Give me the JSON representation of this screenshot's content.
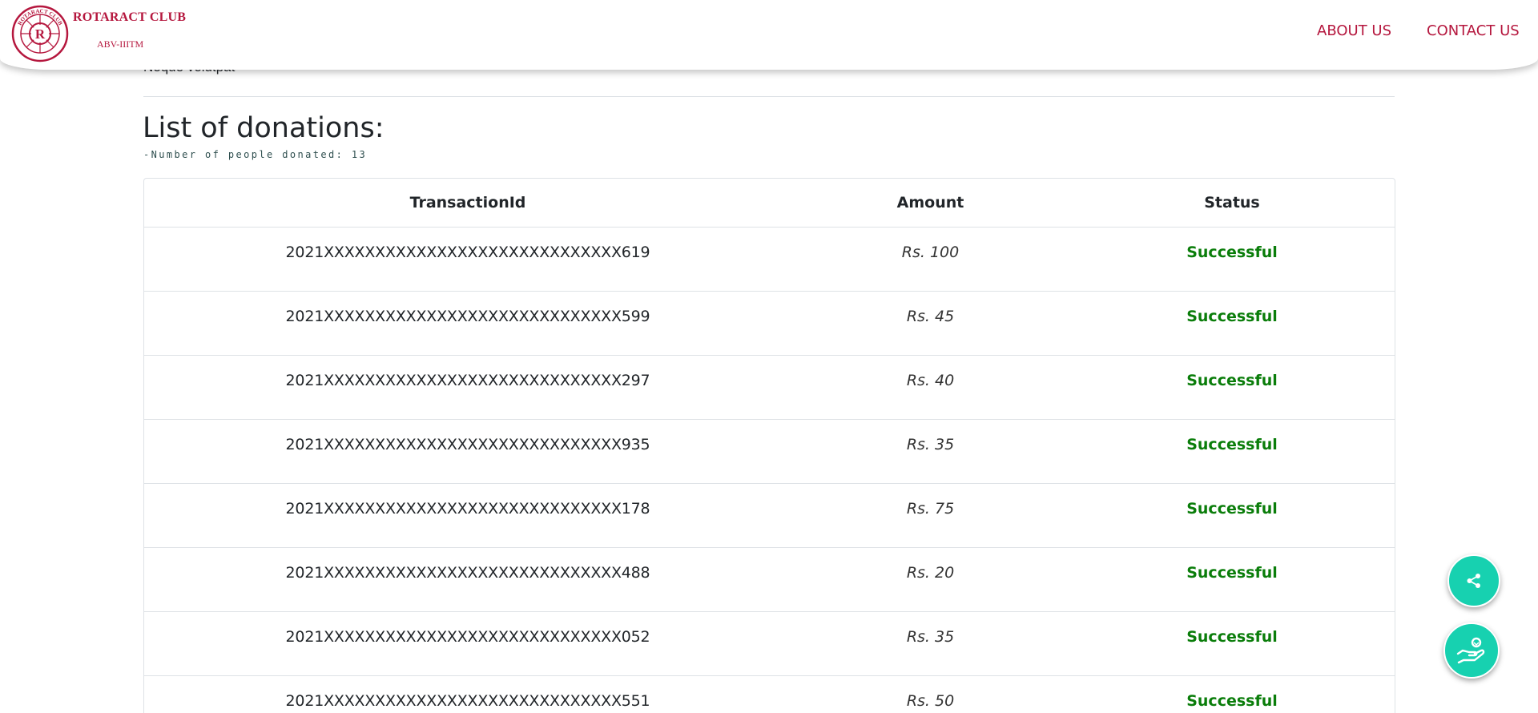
{
  "header": {
    "brand_title": "ROTARACT CLUB",
    "brand_subtitle": "ABV-IIITM",
    "logo_letter": "R",
    "logo_ring_text": "ROTARACT CLUB",
    "nav": {
      "about": "ABOUT US",
      "contact": "CONTACT US"
    },
    "accent_color": "#b5173e"
  },
  "content": {
    "peek_text": "Neque volutpat",
    "title": "List of donations:",
    "donor_count": "-Number of people donated: 13"
  },
  "table": {
    "headers": {
      "transaction": "TransactionId",
      "amount": "Amount",
      "status": "Status"
    },
    "rows": [
      {
        "id": "2021XXXXXXXXXXXXXXXXXXXXXXXXXXXXX619",
        "amount": "Rs. 100",
        "status": "Successful"
      },
      {
        "id": "2021XXXXXXXXXXXXXXXXXXXXXXXXXXXXX599",
        "amount": "Rs. 45",
        "status": "Successful"
      },
      {
        "id": "2021XXXXXXXXXXXXXXXXXXXXXXXXXXXXX297",
        "amount": "Rs. 40",
        "status": "Successful"
      },
      {
        "id": "2021XXXXXXXXXXXXXXXXXXXXXXXXXXXXX935",
        "amount": "Rs. 35",
        "status": "Successful"
      },
      {
        "id": "2021XXXXXXXXXXXXXXXXXXXXXXXXXXXXX178",
        "amount": "Rs. 75",
        "status": "Successful"
      },
      {
        "id": "2021XXXXXXXXXXXXXXXXXXXXXXXXXXXXX488",
        "amount": "Rs. 20",
        "status": "Successful"
      },
      {
        "id": "2021XXXXXXXXXXXXXXXXXXXXXXXXXXXXX052",
        "amount": "Rs. 35",
        "status": "Successful"
      },
      {
        "id": "2021XXXXXXXXXXXXXXXXXXXXXXXXXXXXX551",
        "amount": "Rs. 50",
        "status": "Successful"
      }
    ],
    "status_color": "#0a7d0a"
  },
  "fabs": {
    "share_icon": "share-icon",
    "donate_icon": "hand-heart-icon",
    "color": "#17d1b0"
  }
}
